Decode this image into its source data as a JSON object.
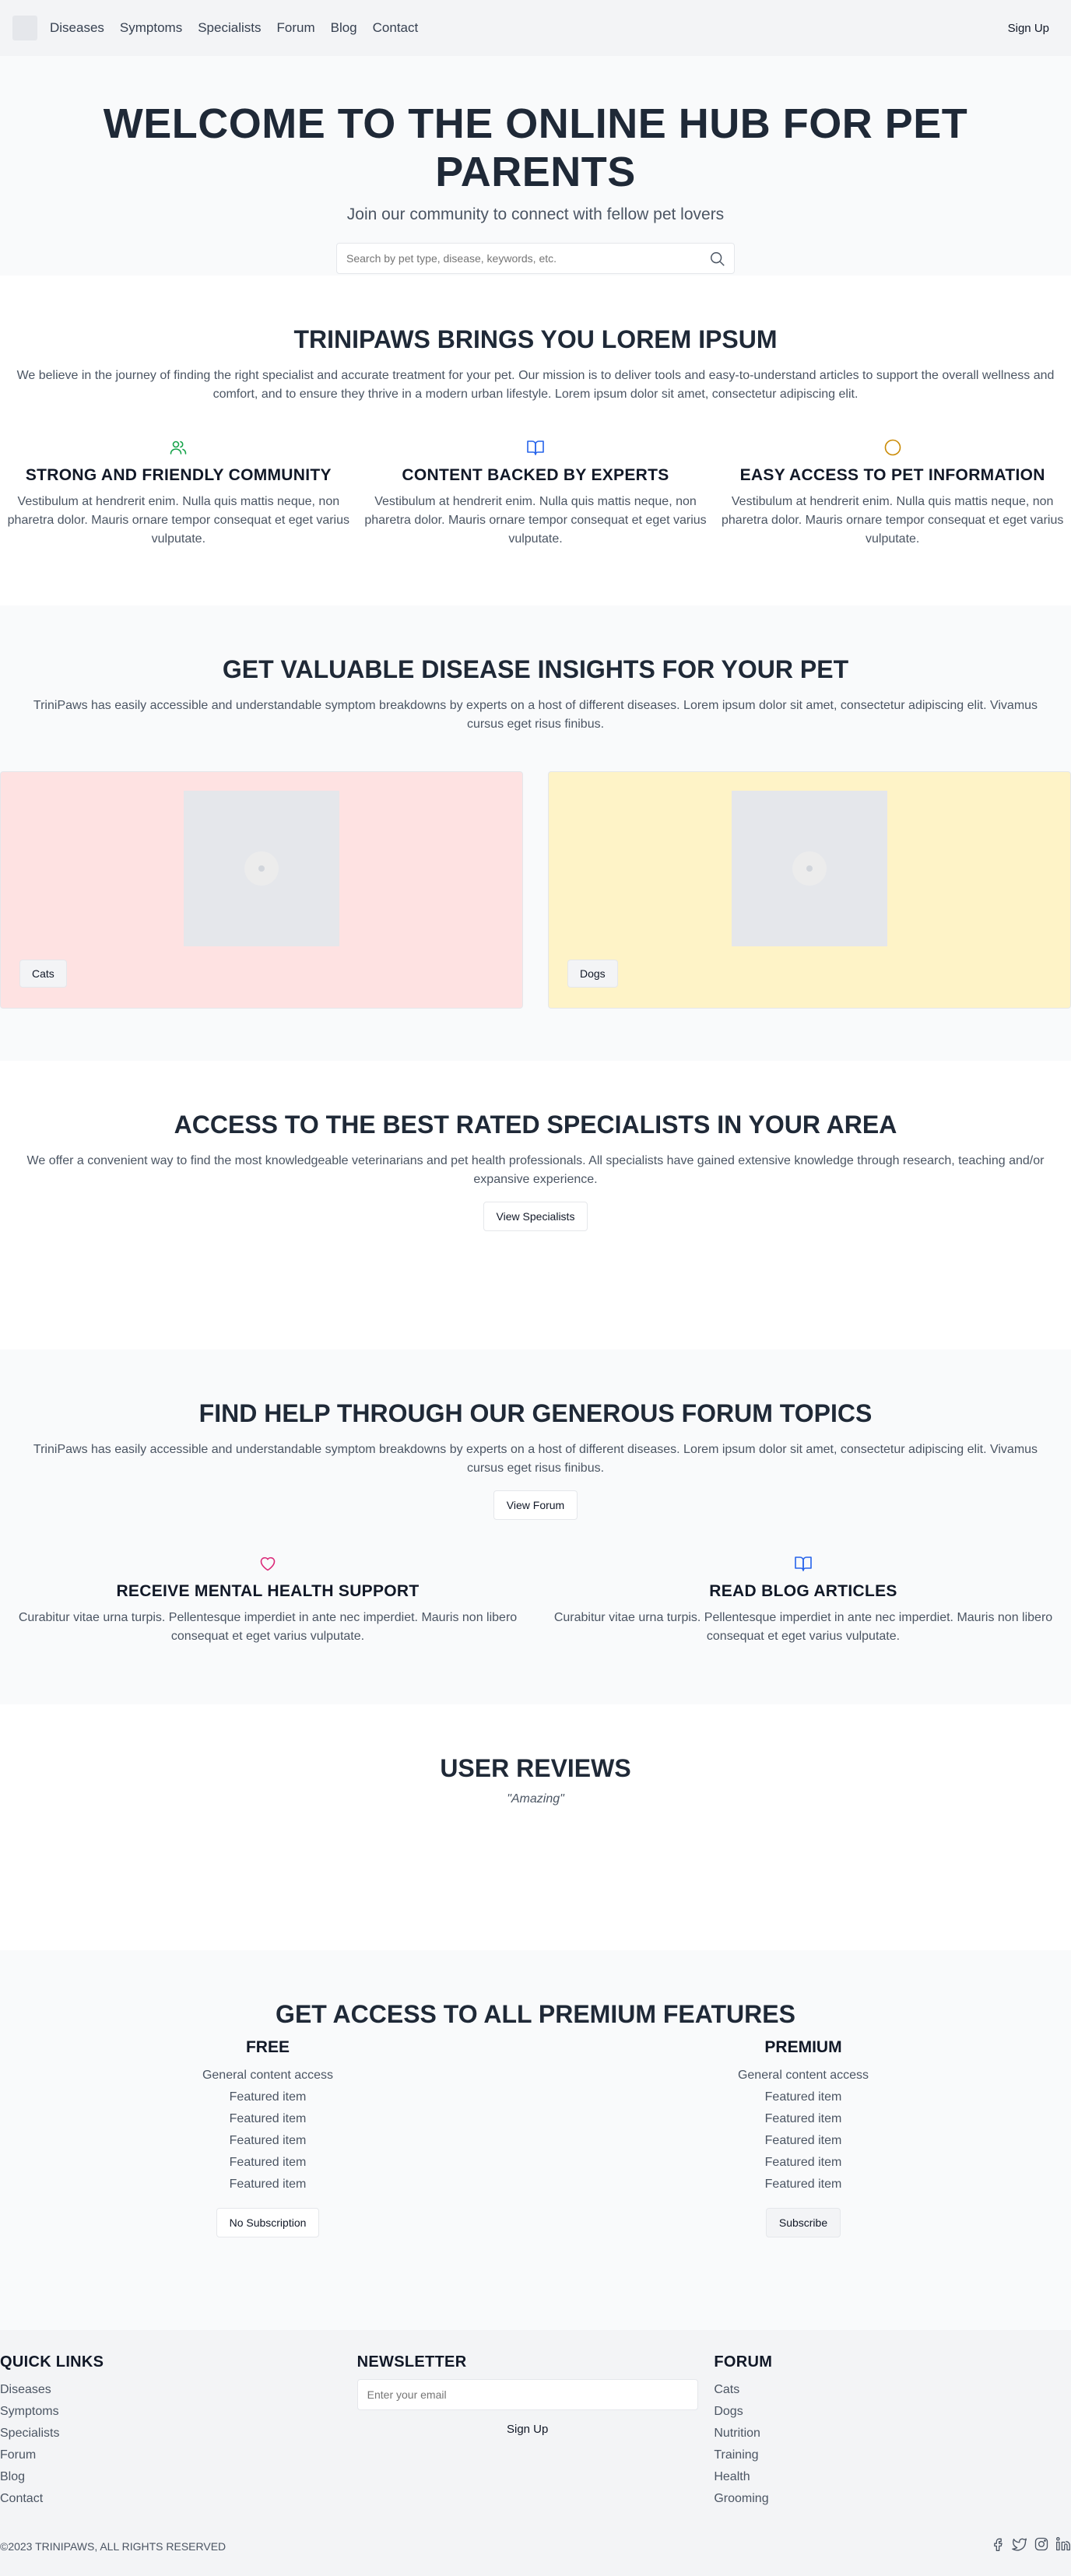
{
  "nav": {
    "links": [
      "Diseases",
      "Symptoms",
      "Specialists",
      "Forum",
      "Blog",
      "Contact"
    ],
    "signup": "Sign Up"
  },
  "hero": {
    "title": "WELCOME TO THE ONLINE HUB FOR PET PARENTS",
    "subtitle": "Join our community to connect with fellow pet lovers",
    "search_placeholder": "Search by pet type, disease, keywords, etc."
  },
  "about": {
    "title": "TRINIPAWS BRINGS YOU LOREM IPSUM",
    "text": "We believe in the journey of finding the right specialist and accurate treatment for your pet. Our mission is to deliver tools and easy-to-understand articles to support the overall wellness and comfort, and to ensure they thrive in a modern urban lifestyle. Lorem ipsum dolor sit amet, consectetur adipiscing elit.",
    "features": [
      {
        "icon": "users-icon",
        "color": "#16a34a",
        "title": "STRONG AND FRIENDLY COMMUNITY",
        "text": "Vestibulum at hendrerit enim. Nulla quis mattis neque, non pharetra dolor. Mauris ornare tempor consequat et eget varius vulputate."
      },
      {
        "icon": "book-icon",
        "color": "#2563eb",
        "title": "CONTENT BACKED BY EXPERTS",
        "text": "Vestibulum at hendrerit enim. Nulla quis mattis neque, non pharetra dolor. Mauris ornare tempor consequat et eget varius vulputate."
      },
      {
        "icon": "circle-icon",
        "color": "#ca8a04",
        "title": "EASY ACCESS TO PET INFORMATION",
        "text": "Vestibulum at hendrerit enim. Nulla quis mattis neque, non pharetra dolor. Mauris ornare tempor consequat et eget varius vulputate."
      }
    ]
  },
  "diseases": {
    "title": "GET VALUABLE DISEASE INSIGHTS FOR YOUR PET",
    "text": "TriniPaws has easily accessible and understandable symptom breakdowns by experts on a host of different diseases. Lorem ipsum dolor sit amet, consectetur adipiscing elit. Vivamus cursus eget risus finibus.",
    "cards": [
      {
        "label": "Cats",
        "color": "#fee2e2"
      },
      {
        "label": "Dogs",
        "color": "#fef3c7"
      }
    ]
  },
  "specialists": {
    "title": "ACCESS TO THE BEST RATED SPECIALISTS IN YOUR AREA",
    "text": "We offer a convenient way to find the most knowledgeable veterinarians and pet health professionals. All specialists have gained extensive knowledge through research, teaching and/or expansive experience.",
    "button": "View Specialists"
  },
  "forum": {
    "title": "FIND HELP THROUGH OUR GENEROUS FORUM TOPICS",
    "text": "TriniPaws has easily accessible and understandable symptom breakdowns by experts on a host of different diseases. Lorem ipsum dolor sit amet, consectetur adipiscing elit. Vivamus cursus eget risus finibus.",
    "button": "View Forum",
    "features": [
      {
        "icon": "heart-icon",
        "color": "#db2777",
        "title": "RECEIVE MENTAL HEALTH SUPPORT",
        "text": "Curabitur vitae urna turpis. Pellentesque imperdiet in ante nec imperdiet. Mauris non libero consequat et eget varius vulputate."
      },
      {
        "icon": "book-icon",
        "color": "#2563eb",
        "title": "READ BLOG ARTICLES",
        "text": "Curabitur vitae urna turpis. Pellentesque imperdiet in ante nec imperdiet. Mauris non libero consequat et eget varius vulputate."
      }
    ]
  },
  "reviews": {
    "title": "USER REVIEWS",
    "quote": "\"Amazing\""
  },
  "premium": {
    "title": "GET ACCESS TO ALL PREMIUM FEATURES",
    "plans": [
      {
        "name": "FREE",
        "items": [
          "General content access",
          "Featured item",
          "Featured item",
          "Featured item",
          "Featured item",
          "Featured item"
        ],
        "button": "No Subscription"
      },
      {
        "name": "PREMIUM",
        "items": [
          "General content access",
          "Featured item",
          "Featured item",
          "Featured item",
          "Featured item",
          "Featured item"
        ],
        "button": "Subscribe"
      }
    ]
  },
  "footer": {
    "quick_links_title": "QUICK LINKS",
    "quick_links": [
      "Diseases",
      "Symptoms",
      "Specialists",
      "Forum",
      "Blog",
      "Contact"
    ],
    "newsletter_title": "NEWSLETTER",
    "newsletter_placeholder": "Enter your email",
    "newsletter_button": "Sign Up",
    "forum_title": "FORUM",
    "forum_links": [
      "Cats",
      "Dogs",
      "Nutrition",
      "Training",
      "Health",
      "Grooming"
    ],
    "copyright": "©2023 TRINIPAWS, ALL RIGHTS RESERVED",
    "socials": [
      "facebook-icon",
      "twitter-icon",
      "instagram-icon",
      "linkedin-icon"
    ]
  }
}
